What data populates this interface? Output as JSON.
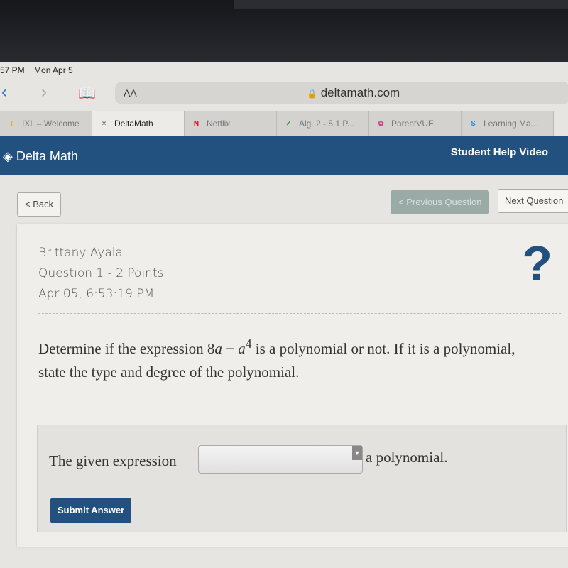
{
  "status": {
    "time": "57 PM",
    "date": "Mon Apr 5"
  },
  "browser": {
    "text_size": "AA",
    "url": "deltamath.com"
  },
  "tabs": [
    {
      "label": "IXL – Welcome",
      "icon": "ixl-icon",
      "color": "#e3b21f"
    },
    {
      "label": "DeltaMath",
      "icon": "close-icon",
      "color": "#777777"
    },
    {
      "label": "Netflix",
      "icon": "netflix-icon",
      "color": "#e50914"
    },
    {
      "label": "Alg. 2 - 5.1 P...",
      "icon": "classroom-icon",
      "color": "#3aa048"
    },
    {
      "label": "ParentVUE",
      "icon": "parentvue-icon",
      "color": "#d04a8a"
    },
    {
      "label": "Learning Ma...",
      "icon": "schoology-icon",
      "color": "#2c8ed6"
    }
  ],
  "header": {
    "logo": "Delta Math",
    "help": "Student Help Video"
  },
  "nav": {
    "back": "< Back",
    "prev": "< Previous Question",
    "next": "Next Question"
  },
  "info": {
    "name": "Brittany Ayala",
    "question": "Question 1 - 2 Points",
    "timestamp": "Apr 05, 6:53:19 PM",
    "help_icon": "?"
  },
  "problem": {
    "text_before": "Determine if the expression 8",
    "var1": "a",
    "minus": " − ",
    "var2": "a",
    "exp": "4",
    "text_after": " is a polynomial or not. If it is a polynomial, state the type and degree of the polynomial."
  },
  "answer": {
    "prefix": "The given expression",
    "select_value": "",
    "suffix": "a polynomial.",
    "submit": "Submit Answer"
  }
}
